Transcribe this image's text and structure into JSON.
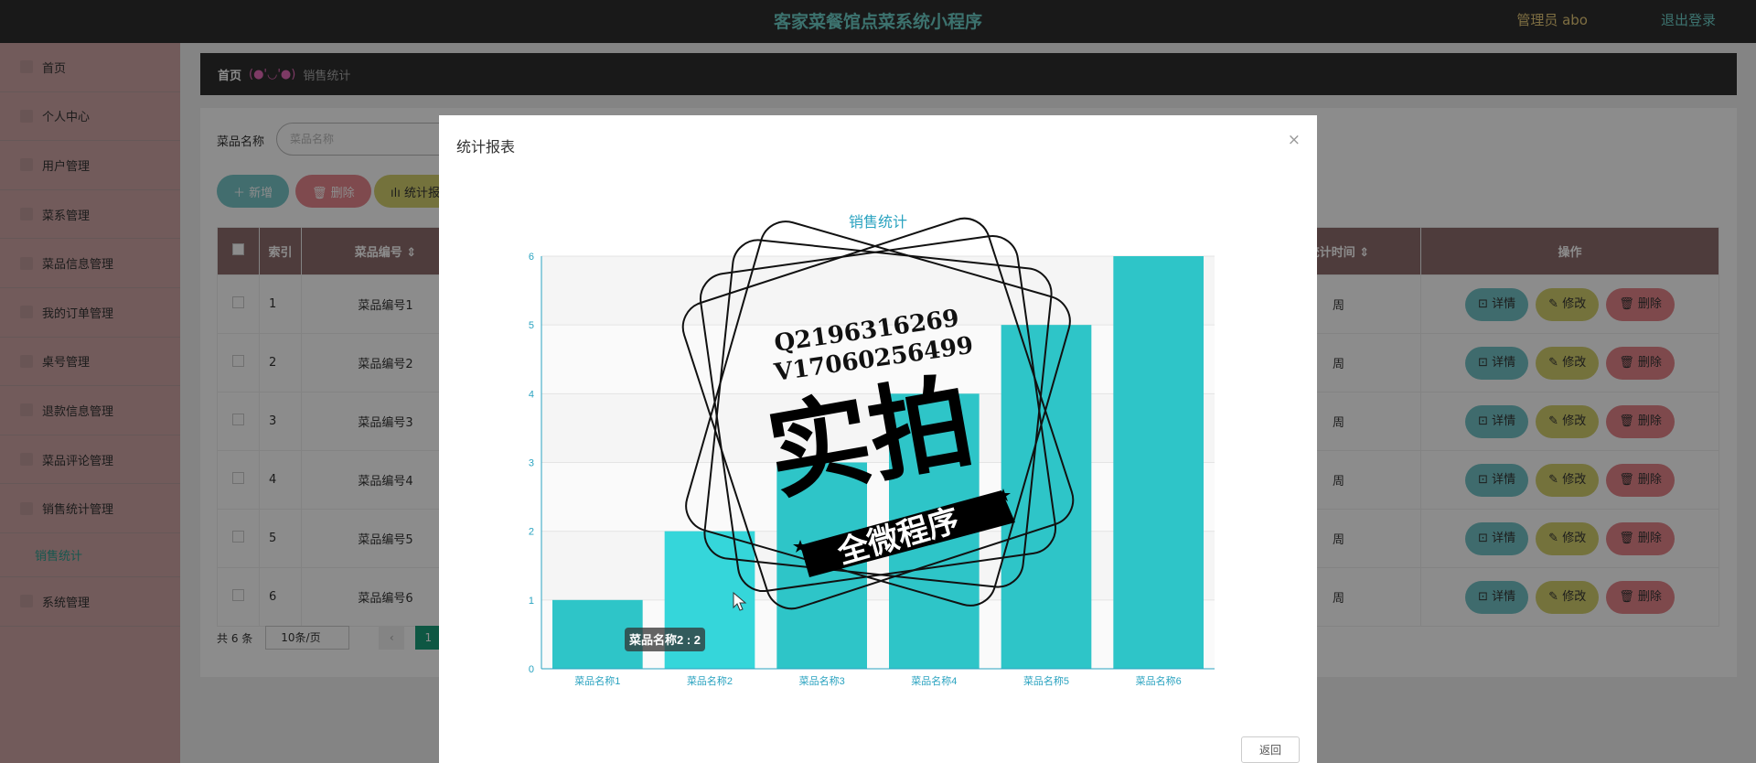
{
  "header": {
    "title": "客家菜餐馆点菜系统小程序",
    "admin_label": "管理员 abo",
    "logout_label": "退出登录"
  },
  "sidebar": {
    "items": [
      {
        "label": "首页"
      },
      {
        "label": "个人中心"
      },
      {
        "label": "用户管理"
      },
      {
        "label": "菜系管理"
      },
      {
        "label": "菜品信息管理"
      },
      {
        "label": "我的订单管理"
      },
      {
        "label": "桌号管理"
      },
      {
        "label": "退款信息管理"
      },
      {
        "label": "菜品评论管理"
      },
      {
        "label": "销售统计管理"
      }
    ],
    "sub_item": "销售统计",
    "last_item": "系统管理"
  },
  "breadcrumb": {
    "home": "首页",
    "sep": "(●'◡'●)",
    "current": "销售统计"
  },
  "search": {
    "label": "菜品名称",
    "placeholder": "菜品名称"
  },
  "toolbar": {
    "add": "＋ 新增",
    "delete": "🗑 删除",
    "stats": "ılı 统计报"
  },
  "table": {
    "headers": [
      "索引",
      "菜品编号 ⇕",
      "统计时间 ⇕",
      "操作"
    ],
    "rows": [
      {
        "index": "1",
        "code": "菜品编号1",
        "time": "周"
      },
      {
        "index": "2",
        "code": "菜品编号2",
        "time": "周"
      },
      {
        "index": "3",
        "code": "菜品编号3",
        "time": "周"
      },
      {
        "index": "4",
        "code": "菜品编号4",
        "time": "周"
      },
      {
        "index": "5",
        "code": "菜品编号5",
        "time": "周"
      },
      {
        "index": "6",
        "code": "菜品编号6",
        "time": "周"
      }
    ],
    "actions": {
      "detail": "⊡ 详情",
      "edit": "✎ 修改",
      "delete": "🗑 删除"
    }
  },
  "pager": {
    "total": "共 6 条",
    "size": "10条/页",
    "page": "1"
  },
  "dialog": {
    "title": "统计报表",
    "close": "×",
    "back": "返回"
  },
  "watermark": {
    "line1": "Q2196316269",
    "line2": "V17060256499",
    "big": "实拍",
    "ribbon": "全微程序"
  },
  "chart_data": {
    "type": "bar",
    "title": "销售统计",
    "categories": [
      "菜品名称1",
      "菜品名称2",
      "菜品名称3",
      "菜品名称4",
      "菜品名称5",
      "菜品名称6"
    ],
    "values": [
      1,
      2,
      3,
      4,
      5,
      6
    ],
    "ylim": [
      0,
      6
    ],
    "yticks": [
      0,
      1,
      2,
      3,
      4,
      5,
      6
    ],
    "bar_color": "#2ec5c8",
    "highlight_color": "#35d6da",
    "tooltip": "菜品名称2 : 2",
    "grid": true
  }
}
